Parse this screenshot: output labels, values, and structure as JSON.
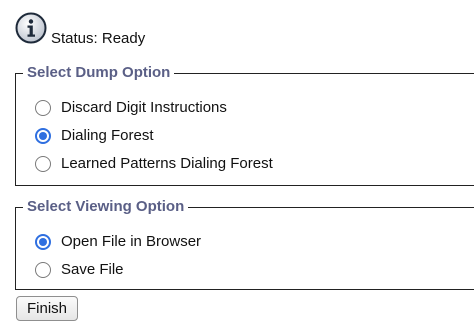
{
  "status": {
    "icon": "info-icon",
    "text": "Status: Ready"
  },
  "dump_option": {
    "legend": "Select Dump Option",
    "options": [
      {
        "label": "Discard Digit Instructions",
        "selected": false
      },
      {
        "label": "Dialing Forest",
        "selected": true
      },
      {
        "label": "Learned Patterns Dialing Forest",
        "selected": false
      }
    ]
  },
  "viewing_option": {
    "legend": "Select Viewing Option",
    "options": [
      {
        "label": "Open File in Browser",
        "selected": true
      },
      {
        "label": "Save File",
        "selected": false
      }
    ]
  },
  "finish_label": "Finish",
  "colors": {
    "legend": "#5a5f86",
    "radio_selected": "#2f6fe0"
  }
}
